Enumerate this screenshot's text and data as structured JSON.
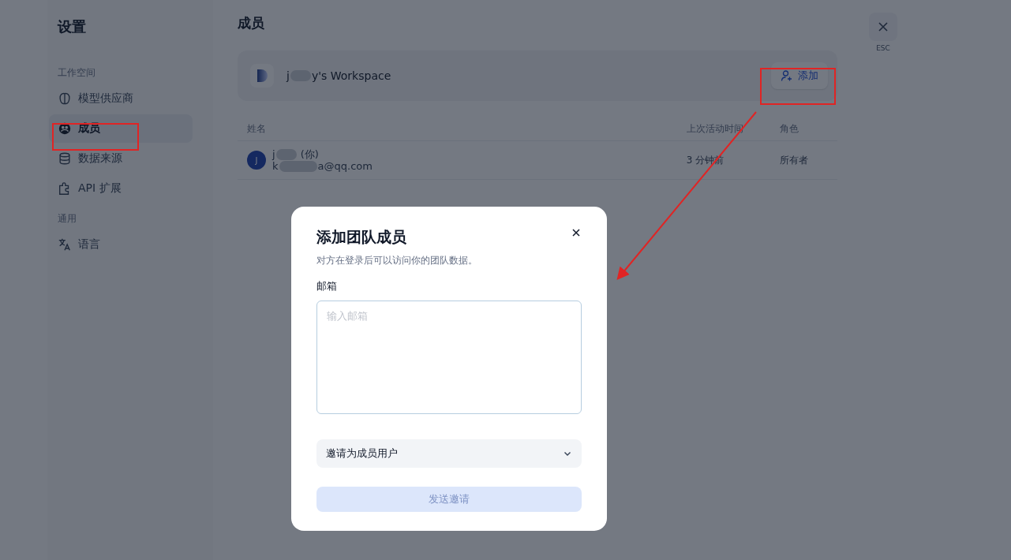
{
  "sidebar": {
    "title": "设置",
    "groups": [
      {
        "heading": "工作空间",
        "items": [
          {
            "label": "模型供应商",
            "selected": false
          },
          {
            "label": "成员",
            "selected": true
          },
          {
            "label": "数据来源",
            "selected": false
          },
          {
            "label": "API 扩展",
            "selected": false
          }
        ]
      },
      {
        "heading": "通用",
        "items": [
          {
            "label": "语言",
            "selected": false
          }
        ]
      }
    ]
  },
  "page": {
    "title": "成员",
    "close_hint": "ESC"
  },
  "workspace": {
    "name_start": "j",
    "name_end": "y's Workspace",
    "add_button": "添加"
  },
  "table": {
    "columns": [
      "姓名",
      "上次活动时间",
      "角色"
    ],
    "rows": [
      {
        "avatar": "J",
        "name_start": "j",
        "name_end": "(你)",
        "email_start": "k",
        "email_end": "a@qq.com",
        "last_active": "3 分钟前",
        "role": "所有者"
      }
    ]
  },
  "dialog": {
    "title": "添加团队成员",
    "description": "对方在登录后可以访问你的团队数据。",
    "email_label": "邮箱",
    "email_placeholder": "输入邮箱",
    "role_select": "邀请为成员用户",
    "submit": "发送邀请",
    "submit_disabled": true
  }
}
